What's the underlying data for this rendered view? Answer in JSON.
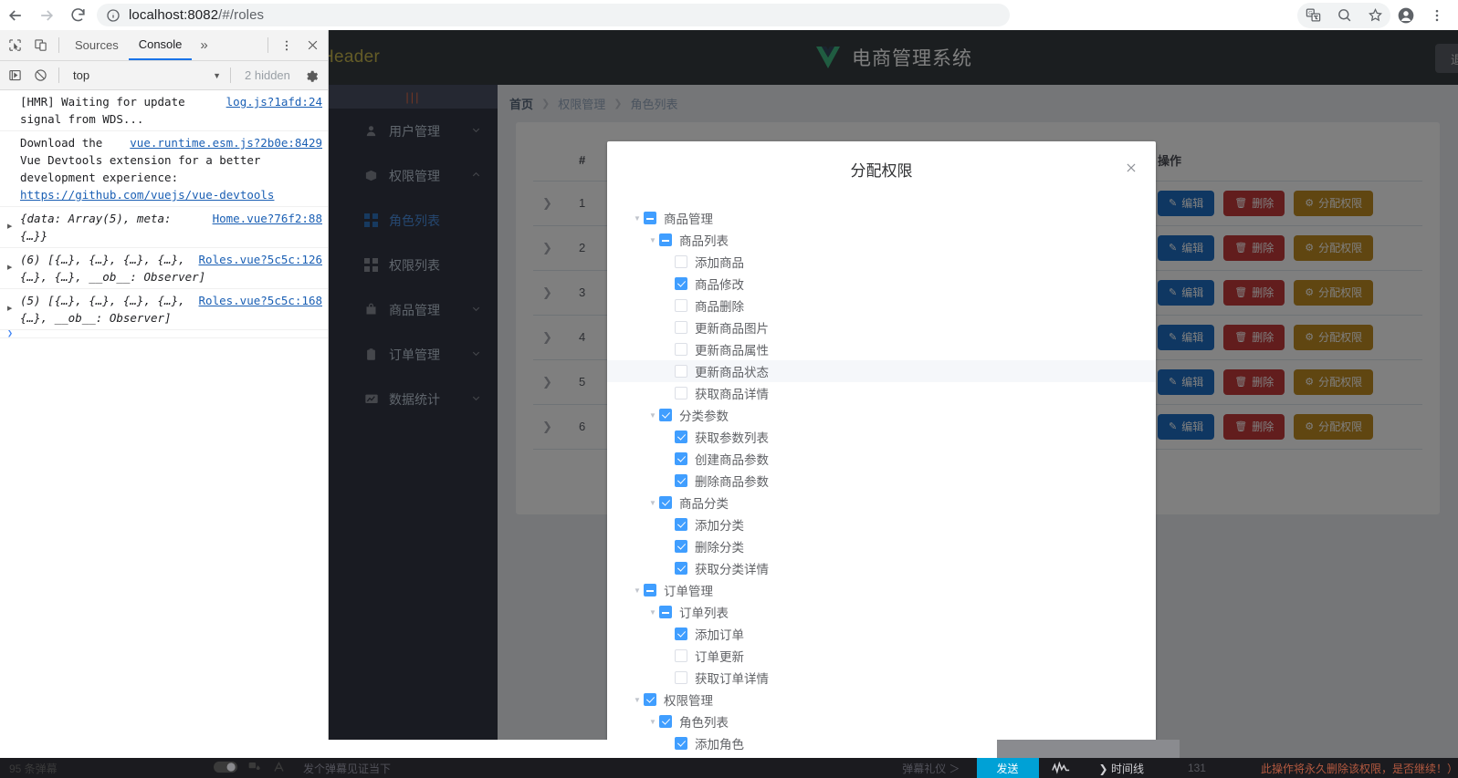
{
  "browser": {
    "url_host": "localhost:8082",
    "url_path": "/#/roles",
    "back_icon": "back-arrow-icon",
    "forward_icon": "forward-arrow-icon",
    "reload_icon": "reload-icon",
    "info_icon": "site-info-icon",
    "translate_icon": "translate-icon",
    "search_icon": "search-icon",
    "bookmark_icon": "star-icon",
    "profile_icon": "profile-avatar-icon",
    "menu_icon": "three-dot-menu-icon"
  },
  "devtools": {
    "inspect_icon": "inspect-element-icon",
    "device_icon": "device-toolbar-icon",
    "tabs": [
      {
        "label": "Sources",
        "active": false
      },
      {
        "label": "Console",
        "active": true
      }
    ],
    "more_tabs": "»",
    "settings_icon": "gear-icon",
    "kebab_icon": "three-dot-menu-icon",
    "close_icon": "close-icon",
    "execute_icon": "execution-context-icon",
    "clear_icon": "clear-console-icon",
    "context_value": "top",
    "hidden_label": "2 hidden",
    "logs": [
      {
        "text": "[HMR] Waiting for update signal from WDS...",
        "source": "log.js?1afd:24",
        "expandable": false,
        "italic": false
      },
      {
        "text": "Download the Vue Devtools extension for a better development experience:",
        "link_text": "https://github.com/vuejs/vue-devtools",
        "source": "vue.runtime.esm.js?2b0e:8429",
        "expandable": false,
        "italic": false
      },
      {
        "text": "{data: Array(5), meta: {…}}",
        "source": "Home.vue?76f2:88",
        "expandable": true,
        "italic": true
      },
      {
        "text": "(6) [{…}, {…}, {…}, {…}, {…}, {…}, __ob__: Observer]",
        "source": "Roles.vue?5c5c:126",
        "expandable": true,
        "italic": true
      },
      {
        "text": "(5) [{…}, {…}, {…}, {…}, {…}, __ob__: Observer]",
        "source": "Roles.vue?5c5c:168",
        "expandable": true,
        "italic": true
      }
    ]
  },
  "page": {
    "header": {
      "left_text": "Header",
      "title": "电商管理系统",
      "logo_icon": "vue-logo-icon",
      "logout_label": "退"
    },
    "sidebar": {
      "toggle_label": "|||",
      "items": [
        {
          "label": "用户管理",
          "icon": "user-icon",
          "caret": "down",
          "type": "group"
        },
        {
          "label": "权限管理",
          "icon": "box-icon",
          "caret": "up",
          "type": "group"
        },
        {
          "label": "角色列表",
          "icon": "grid-icon",
          "type": "sub",
          "active": true
        },
        {
          "label": "权限列表",
          "icon": "grid-icon",
          "type": "sub",
          "active": false
        },
        {
          "label": "商品管理",
          "icon": "bag-icon",
          "caret": "down",
          "type": "group"
        },
        {
          "label": "订单管理",
          "icon": "clipboard-icon",
          "caret": "down",
          "type": "group"
        },
        {
          "label": "数据统计",
          "icon": "chart-icon",
          "caret": "down",
          "type": "group"
        }
      ]
    },
    "breadcrumb": [
      "首页",
      "权限管理",
      "角色列表"
    ],
    "table": {
      "columns": [
        "",
        "#",
        "操作"
      ],
      "action_column_header": "操作",
      "rows": [
        {
          "index": "1"
        },
        {
          "index": "2"
        },
        {
          "index": "3"
        },
        {
          "index": "4"
        },
        {
          "index": "5"
        },
        {
          "index": "6"
        }
      ],
      "buttons": {
        "edit": "编辑",
        "delete": "删除",
        "assign": "分配权限"
      },
      "button_icons": {
        "edit": "pencil-icon",
        "delete": "trash-icon",
        "assign": "gear-icon"
      },
      "expand_icon": "chevron-right-icon"
    }
  },
  "dialog": {
    "title": "分配权限",
    "close_icon": "close-icon",
    "tree": [
      {
        "level": 0,
        "label": "商品管理",
        "state": "indeterminate",
        "caret": true,
        "hover": false
      },
      {
        "level": 1,
        "label": "商品列表",
        "state": "indeterminate",
        "caret": true,
        "hover": false
      },
      {
        "level": 2,
        "label": "添加商品",
        "state": "unchecked",
        "caret": false,
        "hover": false
      },
      {
        "level": 2,
        "label": "商品修改",
        "state": "checked",
        "caret": false,
        "hover": false
      },
      {
        "level": 2,
        "label": "商品删除",
        "state": "unchecked",
        "caret": false,
        "hover": false
      },
      {
        "level": 2,
        "label": "更新商品图片",
        "state": "unchecked",
        "caret": false,
        "hover": false
      },
      {
        "level": 2,
        "label": "更新商品属性",
        "state": "unchecked",
        "caret": false,
        "hover": false
      },
      {
        "level": 2,
        "label": "更新商品状态",
        "state": "unchecked",
        "caret": false,
        "hover": true
      },
      {
        "level": 2,
        "label": "获取商品详情",
        "state": "unchecked",
        "caret": false,
        "hover": false
      },
      {
        "level": 1,
        "label": "分类参数",
        "state": "checked",
        "caret": true,
        "hover": false
      },
      {
        "level": 2,
        "label": "获取参数列表",
        "state": "checked",
        "caret": false,
        "hover": false
      },
      {
        "level": 2,
        "label": "创建商品参数",
        "state": "checked",
        "caret": false,
        "hover": false
      },
      {
        "level": 2,
        "label": "删除商品参数",
        "state": "checked",
        "caret": false,
        "hover": false
      },
      {
        "level": 1,
        "label": "商品分类",
        "state": "checked",
        "caret": true,
        "hover": false
      },
      {
        "level": 2,
        "label": "添加分类",
        "state": "checked",
        "caret": false,
        "hover": false
      },
      {
        "level": 2,
        "label": "删除分类",
        "state": "checked",
        "caret": false,
        "hover": false
      },
      {
        "level": 2,
        "label": "获取分类详情",
        "state": "checked",
        "caret": false,
        "hover": false
      },
      {
        "level": 0,
        "label": "订单管理",
        "state": "indeterminate",
        "caret": true,
        "hover": false
      },
      {
        "level": 1,
        "label": "订单列表",
        "state": "indeterminate",
        "caret": true,
        "hover": false
      },
      {
        "level": 2,
        "label": "添加订单",
        "state": "checked",
        "caret": false,
        "hover": false
      },
      {
        "level": 2,
        "label": "订单更新",
        "state": "unchecked",
        "caret": false,
        "hover": false
      },
      {
        "level": 2,
        "label": "获取订单详情",
        "state": "unchecked",
        "caret": false,
        "hover": false
      },
      {
        "level": 0,
        "label": "权限管理",
        "state": "checked",
        "caret": true,
        "hover": false
      },
      {
        "level": 1,
        "label": "角色列表",
        "state": "checked",
        "caret": true,
        "hover": false
      },
      {
        "level": 2,
        "label": "添加角色",
        "state": "checked",
        "caret": false,
        "hover": false
      }
    ]
  },
  "videobar": {
    "count_label": "95 条弹幕",
    "danmaku_icon": "danmaku-toggle-icon",
    "color_icon": "danmaku-color-icon",
    "font_icon": "danmaku-font-icon",
    "input_placeholder": "发个弹幕见证当下",
    "etiquette_label": "弹幕礼仪 ＞",
    "send_label": "发送",
    "wave_icon": "waveform-icon",
    "time_label": "时间线",
    "right_number": "131",
    "danmaku_text": "此操作将永久删除该权限，是否继续！）"
  }
}
